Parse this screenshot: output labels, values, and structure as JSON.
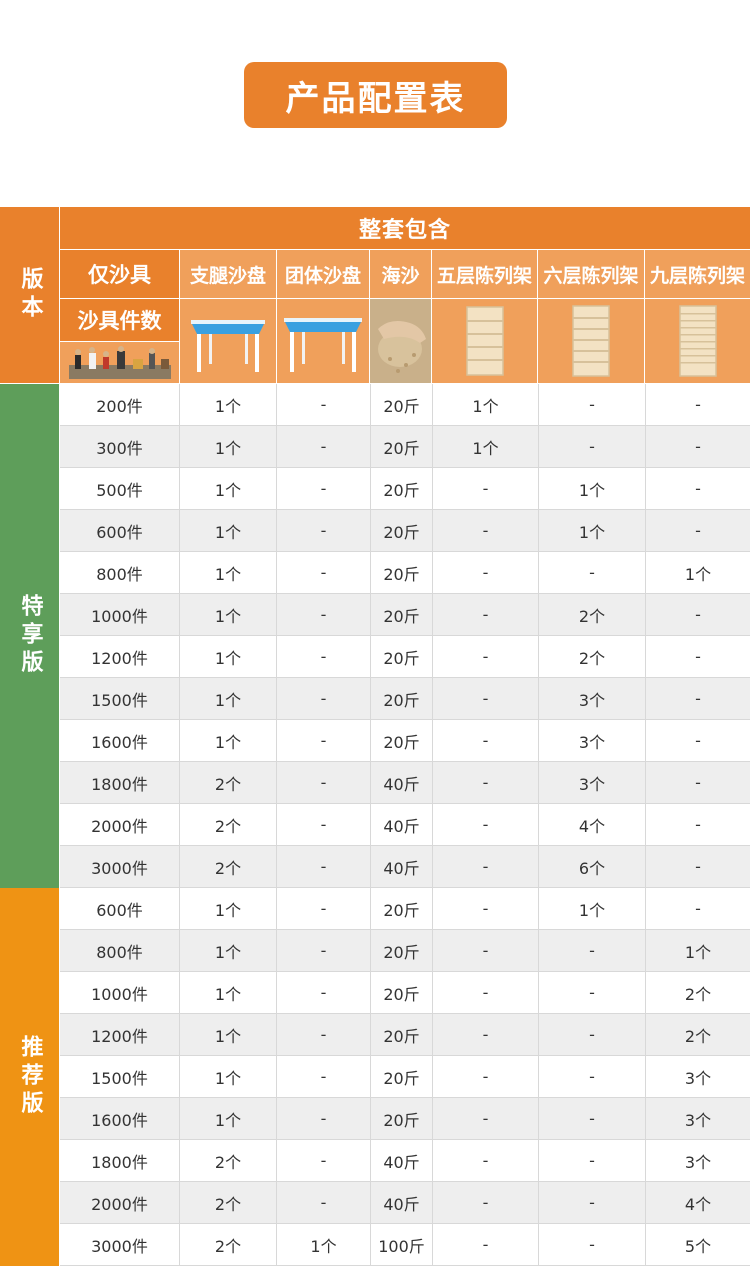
{
  "title": "产品配置表",
  "header": {
    "version": "版本",
    "includes": "整套包含",
    "only_tools": "仅沙具",
    "tool_count": "沙具件数",
    "columns": [
      "支腿沙盘",
      "团体沙盘",
      "海沙",
      "五层陈列架",
      "六层陈列架",
      "九层陈列架"
    ]
  },
  "sections": [
    {
      "label": "特享版",
      "color": "#5e9e5a",
      "rows": [
        [
          "200件",
          "1个",
          "-",
          "20斤",
          "1个",
          "-",
          "-"
        ],
        [
          "300件",
          "1个",
          "-",
          "20斤",
          "1个",
          "-",
          "-"
        ],
        [
          "500件",
          "1个",
          "-",
          "20斤",
          "-",
          "1个",
          "-"
        ],
        [
          "600件",
          "1个",
          "-",
          "20斤",
          "-",
          "1个",
          "-"
        ],
        [
          "800件",
          "1个",
          "-",
          "20斤",
          "-",
          "-",
          "1个"
        ],
        [
          "1000件",
          "1个",
          "-",
          "20斤",
          "-",
          "2个",
          "-"
        ],
        [
          "1200件",
          "1个",
          "-",
          "20斤",
          "-",
          "2个",
          "-"
        ],
        [
          "1500件",
          "1个",
          "-",
          "20斤",
          "-",
          "3个",
          "-"
        ],
        [
          "1600件",
          "1个",
          "-",
          "20斤",
          "-",
          "3个",
          "-"
        ],
        [
          "1800件",
          "2个",
          "-",
          "40斤",
          "-",
          "3个",
          "-"
        ],
        [
          "2000件",
          "2个",
          "-",
          "40斤",
          "-",
          "4个",
          "-"
        ],
        [
          "3000件",
          "2个",
          "-",
          "40斤",
          "-",
          "6个",
          "-"
        ]
      ]
    },
    {
      "label": "推荐版",
      "color": "#ef9314",
      "rows": [
        [
          "600件",
          "1个",
          "-",
          "20斤",
          "-",
          "1个",
          "-"
        ],
        [
          "800件",
          "1个",
          "-",
          "20斤",
          "-",
          "-",
          "1个"
        ],
        [
          "1000件",
          "1个",
          "-",
          "20斤",
          "-",
          "-",
          "2个"
        ],
        [
          "1200件",
          "1个",
          "-",
          "20斤",
          "-",
          "-",
          "2个"
        ],
        [
          "1500件",
          "1个",
          "-",
          "20斤",
          "-",
          "-",
          "3个"
        ],
        [
          "1600件",
          "1个",
          "-",
          "20斤",
          "-",
          "-",
          "3个"
        ],
        [
          "1800件",
          "2个",
          "-",
          "40斤",
          "-",
          "-",
          "3个"
        ],
        [
          "2000件",
          "2个",
          "-",
          "40斤",
          "-",
          "-",
          "4个"
        ],
        [
          "3000件",
          "2个",
          "1个",
          "100斤",
          "-",
          "-",
          "5个"
        ]
      ]
    }
  ]
}
